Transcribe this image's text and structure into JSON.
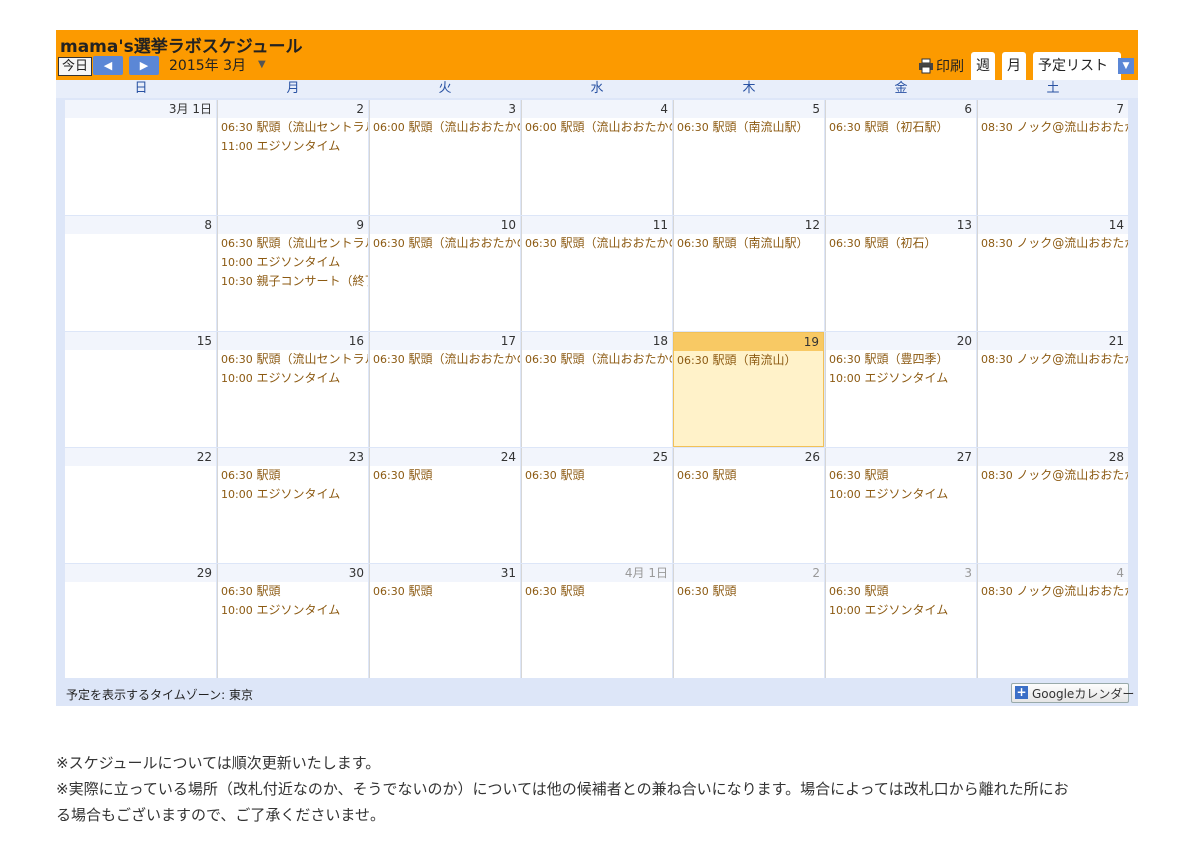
{
  "calendar": {
    "title": "mama's選挙ラボスケジュール",
    "today_label": "今日",
    "prev_icon": "◀",
    "next_icon": "▶",
    "date_range": "2015年 3月",
    "print_label": "印刷",
    "tabs": {
      "week": "週",
      "month": "月",
      "agenda": "予定リスト"
    },
    "weekdays": [
      "日",
      "月",
      "火",
      "水",
      "木",
      "金",
      "土"
    ],
    "timezone_label": "予定を表示するタイムゾーン: 東京",
    "badge": {
      "brand": "Google",
      "label": "カレンダー"
    },
    "accent_color": "#fc9a00",
    "today_color": "#fff2c9",
    "weeks": [
      [
        {
          "day": "3月 1日",
          "events": []
        },
        {
          "day": "2",
          "events": [
            {
              "time": "06:30",
              "title": "駅頭（流山セントラルパーク駅）"
            },
            {
              "time": "11:00",
              "title": "エジソンタイム"
            }
          ]
        },
        {
          "day": "3",
          "events": [
            {
              "time": "06:00",
              "title": "駅頭（流山おおたかの森駅）"
            }
          ]
        },
        {
          "day": "4",
          "events": [
            {
              "time": "06:00",
              "title": "駅頭（流山おおたかの森駅）"
            }
          ]
        },
        {
          "day": "5",
          "events": [
            {
              "time": "06:30",
              "title": "駅頭（南流山駅）"
            }
          ]
        },
        {
          "day": "6",
          "events": [
            {
              "time": "06:30",
              "title": "駅頭（初石駅）"
            }
          ]
        },
        {
          "day": "7",
          "events": [
            {
              "time": "08:30",
              "title": "ノック@流山おおたかの森"
            }
          ]
        }
      ],
      [
        {
          "day": "8",
          "events": []
        },
        {
          "day": "9",
          "events": [
            {
              "time": "06:30",
              "title": "駅頭（流山セントラルパーク駅）"
            },
            {
              "time": "10:00",
              "title": "エジソンタイム"
            },
            {
              "time": "10:30",
              "title": "親子コンサート（終了）"
            }
          ]
        },
        {
          "day": "10",
          "events": [
            {
              "time": "06:30",
              "title": "駅頭（流山おおたかの森駅）"
            }
          ]
        },
        {
          "day": "11",
          "events": [
            {
              "time": "06:30",
              "title": "駅頭（流山おおたかの森駅）"
            }
          ]
        },
        {
          "day": "12",
          "events": [
            {
              "time": "06:30",
              "title": "駅頭（南流山駅）"
            }
          ]
        },
        {
          "day": "13",
          "events": [
            {
              "time": "06:30",
              "title": "駅頭（初石）"
            }
          ]
        },
        {
          "day": "14",
          "events": [
            {
              "time": "08:30",
              "title": "ノック@流山おおたかの森"
            }
          ]
        }
      ],
      [
        {
          "day": "15",
          "events": []
        },
        {
          "day": "16",
          "events": [
            {
              "time": "06:30",
              "title": "駅頭（流山セントラルパーク駅）"
            },
            {
              "time": "10:00",
              "title": "エジソンタイム"
            }
          ]
        },
        {
          "day": "17",
          "events": [
            {
              "time": "06:30",
              "title": "駅頭（流山おおたかの森駅）"
            }
          ]
        },
        {
          "day": "18",
          "events": [
            {
              "time": "06:30",
              "title": "駅頭（流山おおたかの森駅）"
            }
          ]
        },
        {
          "day": "19",
          "today": true,
          "events": [
            {
              "time": "06:30",
              "title": "駅頭（南流山）"
            }
          ]
        },
        {
          "day": "20",
          "events": [
            {
              "time": "06:30",
              "title": "駅頭（豊四季）"
            },
            {
              "time": "10:00",
              "title": "エジソンタイム"
            }
          ]
        },
        {
          "day": "21",
          "events": [
            {
              "time": "08:30",
              "title": "ノック@流山おおたかの森"
            }
          ]
        }
      ],
      [
        {
          "day": "22",
          "events": []
        },
        {
          "day": "23",
          "events": [
            {
              "time": "06:30",
              "title": "駅頭"
            },
            {
              "time": "10:00",
              "title": "エジソンタイム"
            }
          ]
        },
        {
          "day": "24",
          "events": [
            {
              "time": "06:30",
              "title": "駅頭"
            }
          ]
        },
        {
          "day": "25",
          "events": [
            {
              "time": "06:30",
              "title": "駅頭"
            }
          ]
        },
        {
          "day": "26",
          "events": [
            {
              "time": "06:30",
              "title": "駅頭"
            }
          ]
        },
        {
          "day": "27",
          "events": [
            {
              "time": "06:30",
              "title": "駅頭"
            },
            {
              "time": "10:00",
              "title": "エジソンタイム"
            }
          ]
        },
        {
          "day": "28",
          "events": [
            {
              "time": "08:30",
              "title": "ノック@流山おおたかの森"
            }
          ]
        }
      ],
      [
        {
          "day": "29",
          "events": []
        },
        {
          "day": "30",
          "events": [
            {
              "time": "06:30",
              "title": "駅頭"
            },
            {
              "time": "10:00",
              "title": "エジソンタイム"
            }
          ]
        },
        {
          "day": "31",
          "events": [
            {
              "time": "06:30",
              "title": "駅頭"
            }
          ]
        },
        {
          "day": "4月 1日",
          "other": true,
          "events": [
            {
              "time": "06:30",
              "title": "駅頭"
            }
          ]
        },
        {
          "day": "2",
          "other": true,
          "events": [
            {
              "time": "06:30",
              "title": "駅頭"
            }
          ]
        },
        {
          "day": "3",
          "other": true,
          "events": [
            {
              "time": "06:30",
              "title": "駅頭"
            },
            {
              "time": "10:00",
              "title": "エジソンタイム"
            }
          ]
        },
        {
          "day": "4",
          "other": true,
          "events": [
            {
              "time": "08:30",
              "title": "ノック@流山おおたかの森"
            }
          ]
        }
      ]
    ]
  },
  "notes": [
    "※スケジュールについては順次更新いたします。",
    "※実際に立っている場所（改札付近なのか、そうでないのか）については他の候補者との兼ね合いになります。場合によっては改札口から離れた所にお",
    "る場合もございますので、ご了承くださいませ。"
  ]
}
